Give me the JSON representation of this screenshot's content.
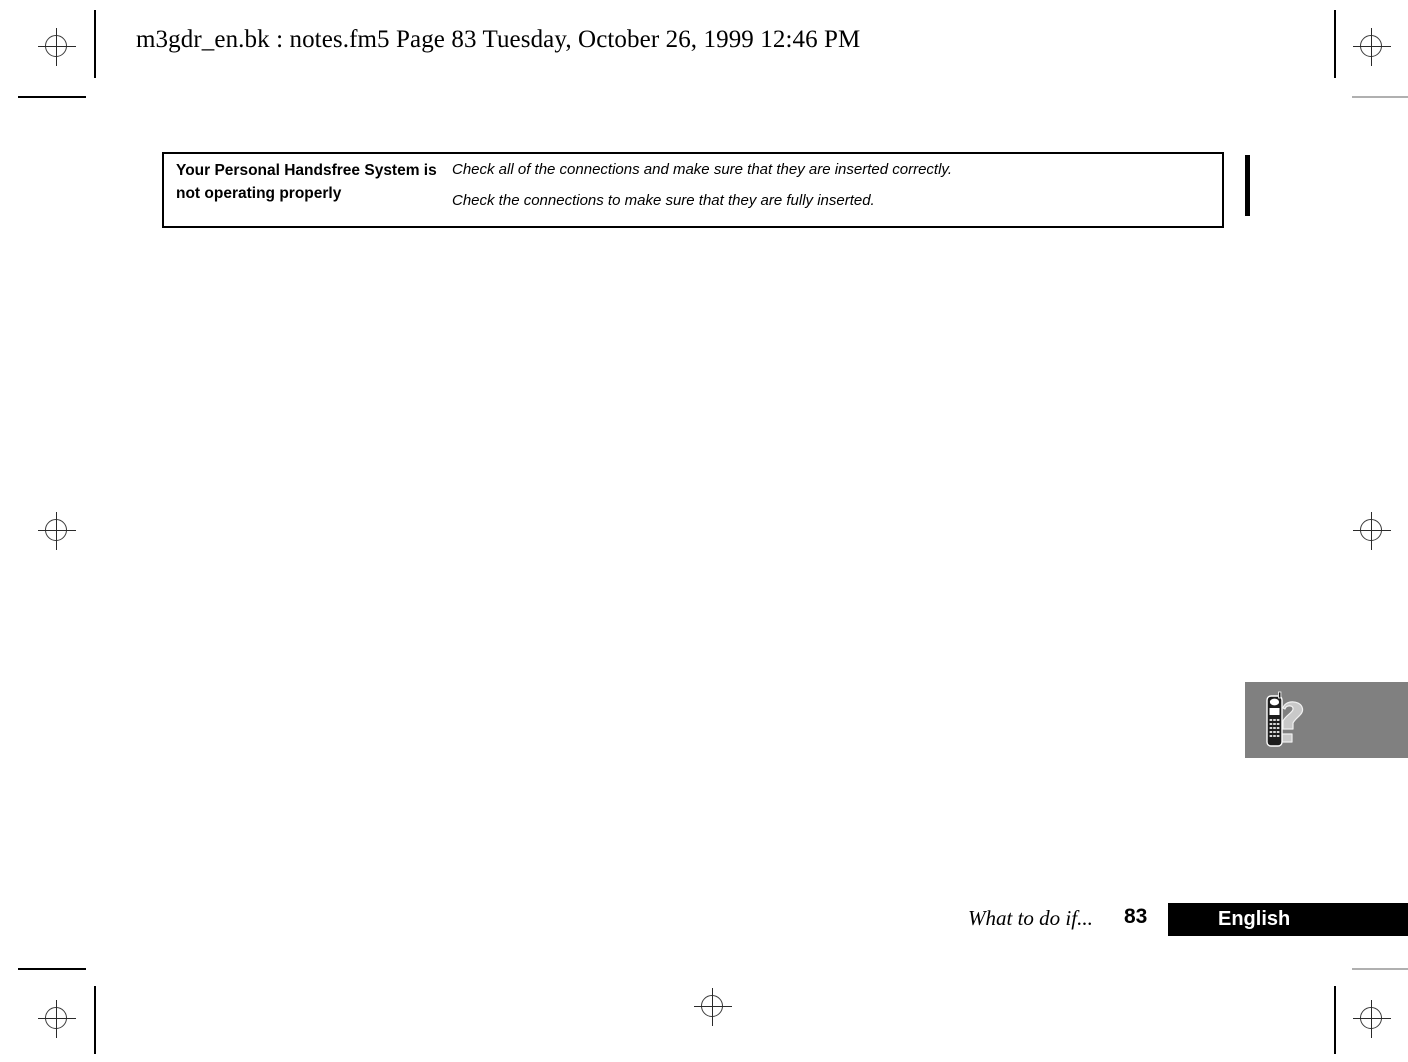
{
  "header": {
    "text": "m3gdr_en.bk : notes.fm5  Page 83  Tuesday, October 26, 1999  12:46 PM"
  },
  "table": {
    "rows": [
      {
        "symptom": "Your Personal Handsfree System is not operating properly",
        "actions": [
          "Check all of the connections and make sure that they are inserted correctly.",
          "Check the connections to make sure that they are fully inserted."
        ]
      }
    ]
  },
  "icon_block": {
    "icon_name": "cordless-phone-question-icon",
    "background_color": "#808080"
  },
  "footer": {
    "chapter": "What to do if...",
    "page_number": "83",
    "language": "English",
    "bar_color": "#000000"
  },
  "print_marks": {
    "registration_icon": "registration-crosshair-icon",
    "crop_mark_color": "#000000"
  }
}
